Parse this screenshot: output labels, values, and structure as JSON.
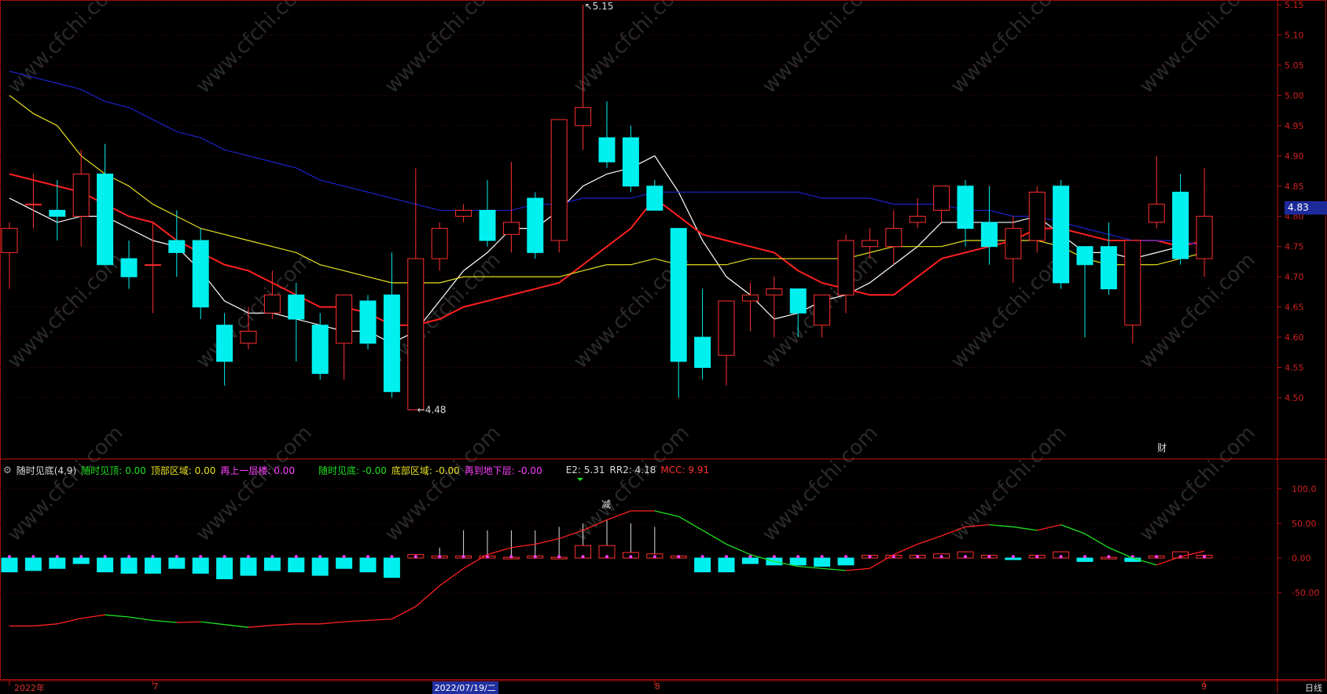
{
  "chart_data": [
    {
      "type": "candlestick",
      "yticks": [
        "5.15",
        "5.10",
        "5.05",
        "5.00",
        "4.95",
        "4.90",
        "4.85",
        "4.80",
        "4.75",
        "4.70",
        "4.65",
        "4.60",
        "4.55",
        "4.50"
      ],
      "ylim": [
        4.455,
        5.155
      ],
      "current_price": "4.83",
      "high_label": "5.15",
      "low_label": "4.48",
      "event_label": "财",
      "candles": [
        {
          "o": 4.74,
          "c": 4.78,
          "h": 4.79,
          "l": 4.68
        },
        {
          "o": 4.82,
          "c": 4.82,
          "h": 4.87,
          "l": 4.78
        },
        {
          "o": 4.81,
          "c": 4.8,
          "h": 4.86,
          "l": 4.76
        },
        {
          "o": 4.8,
          "c": 4.87,
          "h": 4.91,
          "l": 4.75
        },
        {
          "o": 4.87,
          "c": 4.72,
          "h": 4.92,
          "l": 4.72
        },
        {
          "o": 4.73,
          "c": 4.7,
          "h": 4.76,
          "l": 4.68
        },
        {
          "o": 4.72,
          "c": 4.72,
          "h": 4.79,
          "l": 4.64
        },
        {
          "o": 4.76,
          "c": 4.74,
          "h": 4.81,
          "l": 4.7
        },
        {
          "o": 4.76,
          "c": 4.65,
          "h": 4.78,
          "l": 4.63
        },
        {
          "o": 4.62,
          "c": 4.56,
          "h": 4.64,
          "l": 4.52
        },
        {
          "o": 4.59,
          "c": 4.61,
          "h": 4.65,
          "l": 4.58
        },
        {
          "o": 4.64,
          "c": 4.67,
          "h": 4.71,
          "l": 4.63
        },
        {
          "o": 4.67,
          "c": 4.63,
          "h": 4.69,
          "l": 4.56
        },
        {
          "o": 4.62,
          "c": 4.54,
          "h": 4.64,
          "l": 4.53
        },
        {
          "o": 4.59,
          "c": 4.67,
          "h": 4.67,
          "l": 4.53
        },
        {
          "o": 4.66,
          "c": 4.59,
          "h": 4.67,
          "l": 4.58
        },
        {
          "o": 4.67,
          "c": 4.51,
          "h": 4.74,
          "l": 4.5
        },
        {
          "o": 4.48,
          "c": 4.73,
          "h": 4.88,
          "l": 4.48
        },
        {
          "o": 4.73,
          "c": 4.78,
          "h": 4.79,
          "l": 4.71
        },
        {
          "o": 4.8,
          "c": 4.81,
          "h": 4.82,
          "l": 4.79
        },
        {
          "o": 4.81,
          "c": 4.76,
          "h": 4.86,
          "l": 4.75
        },
        {
          "o": 4.77,
          "c": 4.79,
          "h": 4.89,
          "l": 4.74
        },
        {
          "o": 4.83,
          "c": 4.74,
          "h": 4.84,
          "l": 4.73
        },
        {
          "o": 4.76,
          "c": 4.96,
          "h": 4.96,
          "l": 4.74
        },
        {
          "o": 4.95,
          "c": 4.98,
          "h": 5.15,
          "l": 4.91
        },
        {
          "o": 4.93,
          "c": 4.89,
          "h": 4.99,
          "l": 4.88
        },
        {
          "o": 4.93,
          "c": 4.85,
          "h": 4.95,
          "l": 4.84
        },
        {
          "o": 4.85,
          "c": 4.81,
          "h": 4.86,
          "l": 4.81
        },
        {
          "o": 4.78,
          "c": 4.56,
          "h": 4.78,
          "l": 4.5
        },
        {
          "o": 4.6,
          "c": 4.55,
          "h": 4.68,
          "l": 4.53
        },
        {
          "o": 4.57,
          "c": 4.66,
          "h": 4.66,
          "l": 4.52
        },
        {
          "o": 4.66,
          "c": 4.67,
          "h": 4.69,
          "l": 4.61
        },
        {
          "o": 4.67,
          "c": 4.68,
          "h": 4.7,
          "l": 4.6
        },
        {
          "o": 4.68,
          "c": 4.64,
          "h": 4.68,
          "l": 4.6
        },
        {
          "o": 4.62,
          "c": 4.67,
          "h": 4.67,
          "l": 4.6
        },
        {
          "o": 4.67,
          "c": 4.76,
          "h": 4.77,
          "l": 4.64
        },
        {
          "o": 4.75,
          "c": 4.76,
          "h": 4.78,
          "l": 4.73
        },
        {
          "o": 4.75,
          "c": 4.78,
          "h": 4.81,
          "l": 4.72
        },
        {
          "o": 4.79,
          "c": 4.8,
          "h": 4.83,
          "l": 4.78
        },
        {
          "o": 4.81,
          "c": 4.85,
          "h": 4.85,
          "l": 4.79
        },
        {
          "o": 4.85,
          "c": 4.78,
          "h": 4.86,
          "l": 4.75
        },
        {
          "o": 4.79,
          "c": 4.75,
          "h": 4.85,
          "l": 4.72
        },
        {
          "o": 4.73,
          "c": 4.78,
          "h": 4.8,
          "l": 4.69
        },
        {
          "o": 4.76,
          "c": 4.84,
          "h": 4.85,
          "l": 4.74
        },
        {
          "o": 4.85,
          "c": 4.69,
          "h": 4.86,
          "l": 4.68
        },
        {
          "o": 4.75,
          "c": 4.72,
          "h": 4.75,
          "l": 4.6
        },
        {
          "o": 4.75,
          "c": 4.68,
          "h": 4.79,
          "l": 4.67
        },
        {
          "o": 4.62,
          "c": 4.76,
          "h": 4.76,
          "l": 4.59
        },
        {
          "o": 4.79,
          "c": 4.82,
          "h": 4.9,
          "l": 4.78
        },
        {
          "o": 4.84,
          "c": 4.73,
          "h": 4.87,
          "l": 4.72
        },
        {
          "o": 4.73,
          "c": 4.8,
          "h": 4.88,
          "l": 4.7
        }
      ],
      "ma_lines": [
        {
          "color": "#ffffff",
          "values": [
            4.83,
            4.81,
            4.79,
            4.8,
            4.8,
            4.78,
            4.76,
            4.75,
            4.71,
            4.66,
            4.64,
            4.64,
            4.63,
            4.62,
            4.61,
            4.61,
            4.59,
            4.61,
            4.66,
            4.71,
            4.74,
            4.78,
            4.78,
            4.81,
            4.85,
            4.87,
            4.88,
            4.9,
            4.84,
            4.76,
            4.7,
            4.67,
            4.63,
            4.64,
            4.66,
            4.67,
            4.69,
            4.72,
            4.75,
            4.79,
            4.79,
            4.79,
            4.79,
            4.8,
            4.77,
            4.74,
            4.74,
            4.73,
            4.74,
            4.75,
            4.76
          ]
        },
        {
          "color": "#ff2020",
          "values": [
            4.87,
            4.86,
            4.85,
            4.84,
            4.82,
            4.8,
            4.79,
            4.76,
            4.74,
            4.72,
            4.71,
            4.69,
            4.67,
            4.65,
            4.65,
            4.64,
            4.62,
            4.62,
            4.63,
            4.65,
            4.66,
            4.67,
            4.68,
            4.69,
            4.72,
            4.75,
            4.78,
            4.83,
            4.8,
            4.77,
            4.76,
            4.75,
            4.74,
            4.71,
            4.69,
            4.68,
            4.67,
            4.67,
            4.7,
            4.73,
            4.74,
            4.75,
            4.76,
            4.78,
            4.78,
            4.77,
            4.76,
            4.76,
            4.76,
            4.75,
            4.76
          ]
        },
        {
          "color": "#e8e020",
          "values": [
            5.0,
            4.97,
            4.95,
            4.9,
            4.87,
            4.85,
            4.82,
            4.8,
            4.78,
            4.77,
            4.76,
            4.75,
            4.74,
            4.72,
            4.71,
            4.7,
            4.69,
            4.69,
            4.69,
            4.7,
            4.7,
            4.7,
            4.7,
            4.7,
            4.71,
            4.72,
            4.72,
            4.73,
            4.72,
            4.72,
            4.72,
            4.73,
            4.73,
            4.73,
            4.73,
            4.73,
            4.74,
            4.75,
            4.75,
            4.75,
            4.76,
            4.76,
            4.76,
            4.76,
            4.75,
            4.73,
            4.72,
            4.72,
            4.72,
            4.73,
            4.74
          ]
        },
        {
          "color": "#1a24c8",
          "values": [
            5.04,
            5.03,
            5.02,
            5.01,
            4.99,
            4.98,
            4.96,
            4.94,
            4.93,
            4.91,
            4.9,
            4.89,
            4.88,
            4.86,
            4.85,
            4.84,
            4.83,
            4.82,
            4.81,
            4.81,
            4.81,
            4.81,
            4.82,
            4.82,
            4.83,
            4.83,
            4.83,
            4.84,
            4.84,
            4.84,
            4.84,
            4.84,
            4.84,
            4.84,
            4.83,
            4.83,
            4.83,
            4.82,
            4.82,
            4.82,
            4.81,
            4.81,
            4.8,
            4.8,
            4.79,
            4.78,
            4.77,
            4.76,
            4.76,
            4.76,
            4.75
          ]
        }
      ],
      "xlabels": [
        {
          "i": 0,
          "text": "2022年"
        },
        {
          "i": 6,
          "text": "7"
        },
        {
          "i": 19,
          "text": "2022/07/19/二",
          "highlight": true
        },
        {
          "i": 27,
          "text": "8"
        },
        {
          "i": 50,
          "text": "9"
        }
      ],
      "period_label": "日线"
    },
    {
      "type": "indicator",
      "yticks": [
        "100.0",
        "50.00",
        "0.00",
        "-50.00"
      ],
      "ylim": [
        -140,
        140
      ],
      "annotation": "减",
      "bars": [
        -20,
        -18,
        -15,
        -8,
        -20,
        -22,
        -22,
        -15,
        -22,
        -30,
        -25,
        -18,
        -20,
        -25,
        -15,
        -20,
        -28,
        5,
        3,
        3,
        3,
        1,
        3,
        1,
        18,
        18,
        8,
        6,
        3,
        -20,
        -20,
        -8,
        -10,
        -10,
        -12,
        -10,
        4,
        4,
        4,
        6,
        9,
        4,
        -2,
        4,
        9,
        -5,
        1,
        -5,
        3,
        9,
        4
      ],
      "spikes": [
        0,
        0,
        0,
        0,
        0,
        0,
        0,
        0,
        0,
        0,
        0,
        0,
        0,
        0,
        0,
        0,
        0,
        0,
        15,
        40,
        40,
        40,
        40,
        45,
        50,
        55,
        50,
        45,
        0,
        0,
        0,
        0,
        0,
        0,
        0,
        0,
        0,
        0,
        0,
        0,
        0,
        0,
        0,
        0,
        0,
        0,
        0,
        0,
        0,
        0,
        0
      ],
      "line": [
        -98,
        -98,
        -95,
        -87,
        -82,
        -85,
        -90,
        -93,
        -92,
        -96,
        -100,
        -97,
        -95,
        -95,
        -92,
        -90,
        -88,
        -70,
        -40,
        -15,
        5,
        15,
        20,
        28,
        40,
        55,
        68,
        68,
        60,
        40,
        20,
        5,
        -5,
        -12,
        -15,
        -18,
        -15,
        5,
        20,
        32,
        45,
        48,
        45,
        40,
        48,
        35,
        15,
        0,
        -10,
        2,
        10
      ],
      "legend": [
        {
          "text": "随时见底(4,9)",
          "color": "#dddddd"
        },
        {
          "text": "随时见顶: 0.00",
          "color": "#20e020"
        },
        {
          "text": "顶部区域: 0.00",
          "color": "#e8e020"
        },
        {
          "text": "再上一层楼: 0.00",
          "color": "#ff40ff"
        },
        {
          "text": "随时见底: -0.00",
          "color": "#20e020"
        },
        {
          "text": "底部区域: -0.00",
          "color": "#e8e020"
        },
        {
          "text": "再到地下层: -0.00",
          "color": "#ff40ff"
        },
        {
          "text": "E2: 5.31",
          "color": "#dddddd"
        },
        {
          "text": "RR2: 4.18",
          "color": "#dddddd"
        },
        {
          "text": "MCC: 9.91",
          "color": "#ff3030"
        }
      ]
    }
  ],
  "watermark": "www.cfchi.com"
}
